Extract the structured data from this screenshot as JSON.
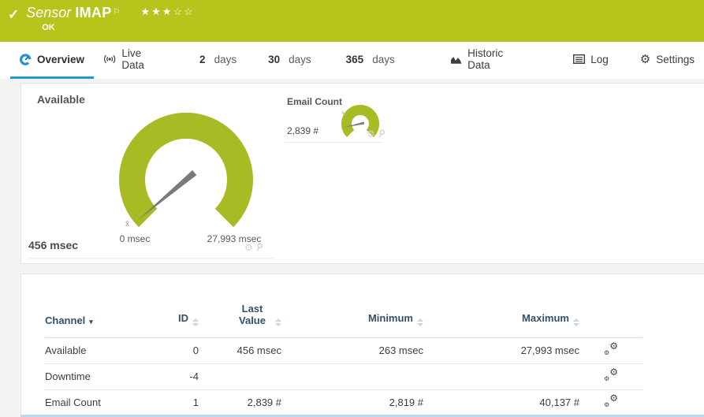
{
  "header": {
    "type_label": "Sensor",
    "name": "IMAP",
    "status": "OK",
    "stars_filled": "★★★",
    "stars_empty": "☆☆"
  },
  "icons": {
    "check": "✓",
    "flag": "⚐",
    "gear": "⚙",
    "sort_desc": "▾"
  },
  "tabs": [
    {
      "label": "Overview"
    },
    {
      "label": "Live Data"
    },
    {
      "number": "2",
      "suffix": "days"
    },
    {
      "number": "30",
      "suffix": "days"
    },
    {
      "number": "365",
      "suffix": "days"
    },
    {
      "label": "Historic Data"
    },
    {
      "label": "Log"
    },
    {
      "label": "Settings"
    }
  ],
  "gauges": {
    "available": {
      "title": "Available",
      "value": "456 msec",
      "scale_min": "0 msec",
      "scale_max": "27,993 msec",
      "avg_marker": "x̄"
    },
    "email_count": {
      "title": "Email Count",
      "value": "2,839 #"
    }
  },
  "table": {
    "headers": {
      "channel": "Channel",
      "id": "ID",
      "last_value": "Last Value",
      "minimum": "Minimum",
      "maximum": "Maximum"
    },
    "rows": [
      {
        "channel": "Available",
        "id": "0",
        "last_value": "456 msec",
        "minimum": "263 msec",
        "maximum": "27,993 msec"
      },
      {
        "channel": "Downtime",
        "id": "-4",
        "last_value": "",
        "minimum": "",
        "maximum": ""
      },
      {
        "channel": "Email Count",
        "id": "1",
        "last_value": "2,839 #",
        "minimum": "2,819 #",
        "maximum": "40,137 #"
      }
    ]
  },
  "colors": {
    "brand_green": "#b6c41c",
    "gauge_green": "#a8ba24",
    "active_tab_blue": "#1e9cd8",
    "table_header_blue": "#33506b"
  }
}
